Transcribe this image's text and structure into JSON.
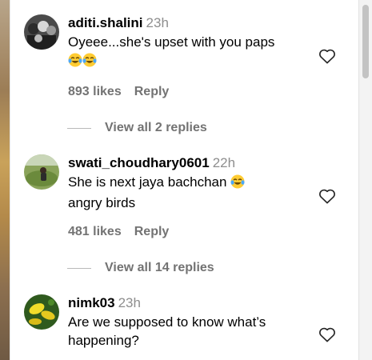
{
  "comments": [
    {
      "username": "aditi.shalini",
      "time": "23h",
      "text": "Oyeee...she's upset with you paps",
      "emoji_count": 2,
      "likes": "893 likes",
      "reply_label": "Reply",
      "view_replies": "View all 2 replies"
    },
    {
      "username": "swati_choudhary0601",
      "time": "22h",
      "text_line1": "She is next jaya bachchan",
      "text_line2": "angry birds",
      "likes": "481 likes",
      "reply_label": "Reply",
      "view_replies": "View all 14 replies"
    },
    {
      "username": "nimk03",
      "time": "23h",
      "text_line1": "Are we supposed to know what’s",
      "text_line2": "happening?"
    }
  ],
  "icons": {
    "like": "heart-outline-icon",
    "emoji": "face-with-tears-of-joy-icon"
  },
  "colors": {
    "secondary_text": "#737373",
    "timestamp": "#8e8e8e"
  }
}
